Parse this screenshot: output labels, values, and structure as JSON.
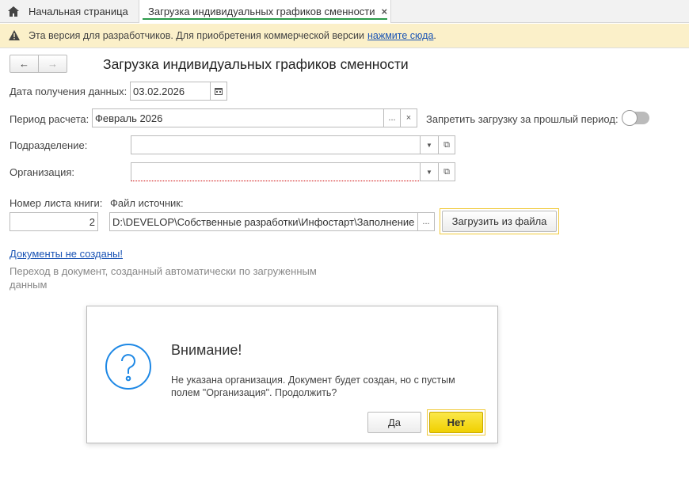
{
  "tabs": [
    {
      "label": "Начальная страница",
      "icon": "home-icon"
    },
    {
      "label": "Загрузка индивидуальных графиков сменности",
      "close": "×"
    }
  ],
  "banner": {
    "text": "Эта версия для разработчиков. Для приобретения коммерческой версии",
    "link": "нажмите сюда",
    "suffix": "."
  },
  "nav": {
    "back": "←",
    "forward": "→"
  },
  "page_title": "Загрузка индивидуальных графиков сменности",
  "form": {
    "date_label": "Дата получения данных:",
    "date_value": "03.02.2026",
    "period_label": "Период расчета:",
    "period_value": "Февраль 2026",
    "select_btn": "...",
    "clear_btn": "×",
    "forbid_label": "Запретить загрузку за прошлый период:",
    "forbid_on": false,
    "department_label": "Подразделение:",
    "department_value": "",
    "organization_label": "Организация:",
    "organization_value": "",
    "sheet_label": "Номер листа книги:",
    "sheet_value": "2",
    "file_label": "Файл источник:",
    "file_value": "D:\\DEVELOP\\Собственные разработки\\Инфостарт\\Заполнение и",
    "load_button": "Загрузить из файла"
  },
  "docs_link": "Документы не созданы!",
  "hint": "Переход в документ, созданный автоматически по загруженным данным",
  "dialog": {
    "title": "Внимание!",
    "message": "Не указана организация. Документ будет создан, но с пустым полем \"Организация\". Продолжить?",
    "yes": "Да",
    "no": "Нет",
    "icon": "question-icon"
  },
  "colors": {
    "accent_green": "#2b9a4b",
    "banner": "#fbf0c9",
    "link": "#1a54b5",
    "primary_button": "#f5d800",
    "icon_blue": "#1e88e5"
  }
}
